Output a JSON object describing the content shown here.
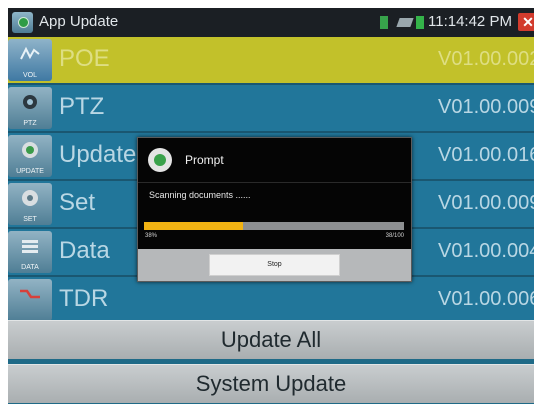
{
  "statusbar": {
    "app_title": "App Update",
    "time": "11:14:42 PM",
    "close_glyph": "✕",
    "icons": [
      "app-icon",
      "sim-icon",
      "usb-icon",
      "battery-icon",
      "close-icon"
    ]
  },
  "items": [
    {
      "name": "POE",
      "version": "V01.00.002",
      "icon_label": "VOL",
      "icon": "vol-icon",
      "selected": true
    },
    {
      "name": "PTZ",
      "version": "V01.00.009",
      "icon_label": "PTZ",
      "icon": "ptz-camera-icon",
      "selected": false
    },
    {
      "name": "Update",
      "version": "V01.00.016",
      "icon_label": "UPDATE",
      "icon": "update-gear-icon",
      "selected": false
    },
    {
      "name": "Set",
      "version": "V01.00.009",
      "icon_label": "SET",
      "icon": "set-gear-icon",
      "selected": false
    },
    {
      "name": "Data",
      "version": "V01.00.004",
      "icon_label": "DATA",
      "icon": "data-icon",
      "selected": false
    },
    {
      "name": "TDR",
      "version": "V01.00.006",
      "icon_label": "",
      "icon": "tdr-wave-icon",
      "selected": false
    }
  ],
  "buttons": {
    "update_all": "Update All",
    "system_update": "System Update"
  },
  "dialog": {
    "title": "Prompt",
    "message": "Scanning documents ......",
    "progress_percent": 38,
    "progress_label": "38%",
    "progress_count": "38/100",
    "stop_label": "Stop",
    "colors": {
      "progress_fill": "#f2b313",
      "progress_track": "#8d8f91"
    }
  },
  "colors": {
    "row_bg": "#21769a",
    "selected_row_bg": "#c2c12a",
    "status_bar": "#1b1f24"
  }
}
